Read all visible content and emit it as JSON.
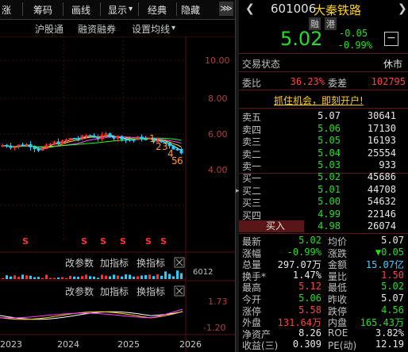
{
  "toolbar": {
    "items": [
      "涨",
      "筹码",
      "画线",
      "显示",
      "经典",
      "隐藏"
    ],
    "dropdown_glyph": "▾",
    "more_glyph": "⋙"
  },
  "subbar": {
    "hgt": "沪股通",
    "margin": "融资融券",
    "settings": "设置均线",
    "dropdown_glyph": "▾"
  },
  "chart": {
    "y_ticks": [
      "10.00",
      "8.00",
      "6.00",
      "4.00"
    ],
    "markers": [
      "1",
      "2",
      "3",
      "4",
      "5",
      "6"
    ],
    "s_marks": [
      "S",
      "S",
      "S",
      "S",
      "S",
      "S"
    ],
    "vol_label": "6012",
    "sub1": {
      "change": "改参数",
      "add": "加指标",
      "swap": "换指标"
    },
    "sub2": {
      "change": "改参数",
      "add": "加指标",
      "swap": "换指标"
    },
    "macd_ticks": [
      "1.73",
      "-1.20"
    ],
    "x_labels": [
      "2023",
      "2024",
      "2025",
      "2026"
    ],
    "colors": {
      "up": "#ff3030",
      "down": "#20d0ff",
      "ma5": "#ffffff",
      "ma10": "#ffd000",
      "ma20": "#ff40ff",
      "ma60": "#20ff20"
    }
  },
  "stock": {
    "code": "601006",
    "name": "大秦铁路",
    "tag1": "融",
    "tag2": "港",
    "price": "5.02",
    "change": "-0.05",
    "change_pct": "-0.99%",
    "minus_btn": "−"
  },
  "status": {
    "label": "交易状态",
    "value": "休市"
  },
  "ratio": {
    "label1": "委比",
    "value1": "36.23%",
    "label2": "委差",
    "value2": "102795"
  },
  "promo": "抓住机会，即刻开户!",
  "asks": [
    {
      "label": "卖五",
      "price": "5.07",
      "vol": "30641"
    },
    {
      "label": "卖四",
      "price": "5.06",
      "vol": "17130"
    },
    {
      "label": "卖三",
      "price": "5.05",
      "vol": "16193"
    },
    {
      "label": "卖二",
      "price": "5.04",
      "vol": "25554"
    },
    {
      "label": "卖一",
      "price": "5.03",
      "vol": "933"
    }
  ],
  "bids": [
    {
      "label": "买一",
      "price": "5.02",
      "vol": "45686"
    },
    {
      "label": "买二",
      "price": "5.01",
      "vol": "44708"
    },
    {
      "label": "买三",
      "price": "5.00",
      "vol": "54632"
    },
    {
      "label": "买四",
      "price": "4.99",
      "vol": "22146"
    },
    {
      "label": "买五",
      "price": "4.98",
      "vol": "26074"
    }
  ],
  "buy_btn": "买入",
  "stats": [
    {
      "l1": "最新",
      "v1": "5.02",
      "c1": "green",
      "l2": "均价",
      "v2": "5.07",
      "c2": "white"
    },
    {
      "l1": "涨幅",
      "v1": "-0.99%",
      "c1": "green",
      "l2": "涨跌",
      "v2": "▼0.05",
      "c2": "green"
    },
    {
      "l1": "总量",
      "v1": "297.07万",
      "c1": "white",
      "l2": "金额",
      "v2": "15.07亿",
      "c2": "cyan"
    },
    {
      "l1": "换手*",
      "v1": "1.47%",
      "c1": "white",
      "l2": "量比",
      "v2": "1.50",
      "c2": "red"
    },
    {
      "l1": "最高",
      "v1": "5.12",
      "c1": "red",
      "l2": "最低",
      "v2": "5.02",
      "c2": "green"
    },
    {
      "l1": "今开",
      "v1": "5.06",
      "c1": "green",
      "l2": "昨收",
      "v2": "5.07",
      "c2": "white"
    },
    {
      "l1": "涨停",
      "v1": "5.58",
      "c1": "red",
      "l2": "跌停",
      "v2": "4.56",
      "c2": "green"
    },
    {
      "l1": "外盘",
      "v1": "131.64万",
      "c1": "red",
      "l2": "内盘",
      "v2": "165.43万",
      "c2": "green"
    },
    {
      "l1": "净资产",
      "v1": "8.26",
      "c1": "white",
      "l2": "ROE",
      "v2": "3.82%",
      "c2": "white"
    },
    {
      "l1": "收益(三)",
      "v1": "0.309",
      "c1": "white",
      "l2": "PE(动)",
      "v2": "12.19",
      "c2": "white"
    }
  ]
}
